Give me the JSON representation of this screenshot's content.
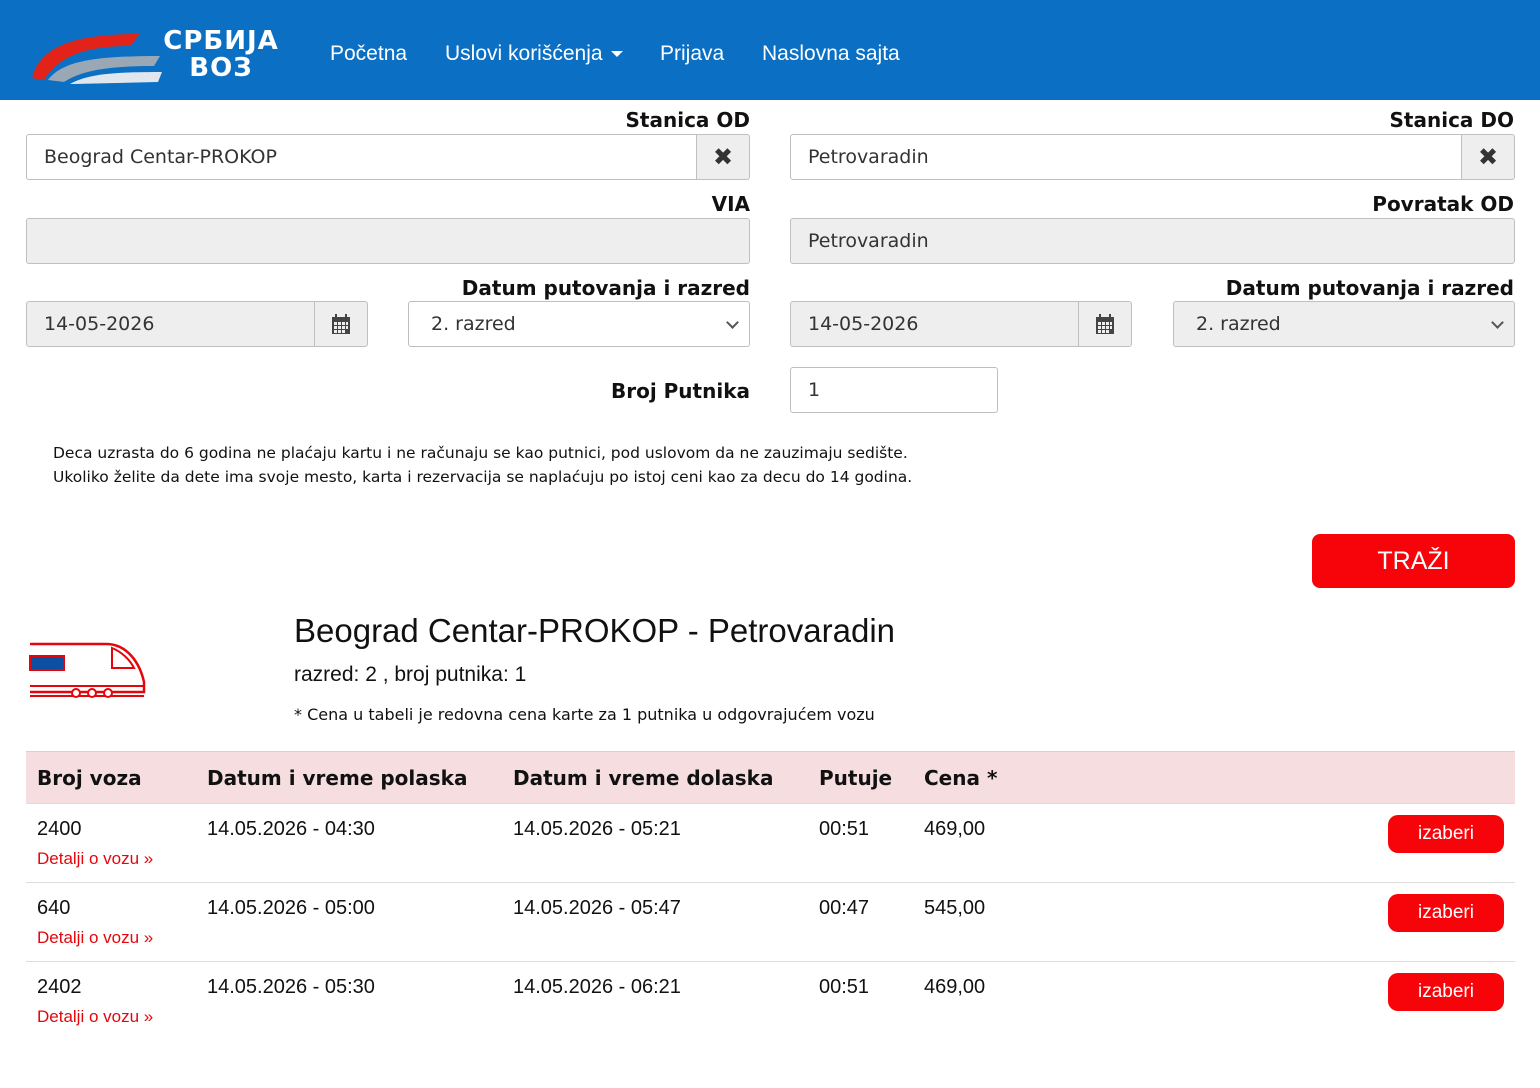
{
  "nav": {
    "logo_line1": "СРБИЈА",
    "logo_line2": "ВОЗ",
    "items": [
      "Početna",
      "Uslovi korišćenja",
      "Prijava",
      "Naslovna sajta"
    ]
  },
  "form": {
    "from_label": "Stanica OD",
    "from_value": "Beograd Centar-PROKOP",
    "to_label": "Stanica DO",
    "to_value": "Petrovaradin",
    "via_label": "VIA",
    "via_value": "",
    "return_label": "Povratak OD",
    "return_value": "Petrovaradin",
    "date_label": "Datum putovanja i razred",
    "date_value": "14-05-2026",
    "class_value": "2. razred",
    "return_date_label": "Datum putovanja i razred",
    "return_date_value": "14-05-2026",
    "return_class_value": "2. razred",
    "passengers_label": "Broj Putnika",
    "passengers_value": "1",
    "note_line1": "Deca uzrasta do 6 godina ne plaćaju kartu i ne računaju se kao putnici, pod uslovom da ne zauzimaju sedište.",
    "note_line2": "Ukoliko želite da dete ima svoje mesto, karta i rezervacija se naplaćuju po istoj ceni kao za decu do 14 godina.",
    "search_label": "TRAŽI"
  },
  "result": {
    "title": "Beograd Centar-PROKOP - Petrovaradin",
    "subtitle": "razred: 2 , broj putnika: 1",
    "price_note": "* Cena u tabeli je redovna cena karte za 1 putnika u odgovrajućem vozu",
    "columns": [
      "Broj voza",
      "Datum i vreme polaska",
      "Datum i vreme dolaska",
      "Putuje",
      "Cena *"
    ],
    "details_label": "Detalji o vozu »",
    "select_label": "izaberi",
    "rows": [
      {
        "train": "2400",
        "departure": "14.05.2026 - 04:30",
        "arrival": "14.05.2026 - 05:21",
        "duration": "00:51",
        "price": "469,00"
      },
      {
        "train": "640",
        "departure": "14.05.2026 - 05:00",
        "arrival": "14.05.2026 - 05:47",
        "duration": "00:47",
        "price": "545,00"
      },
      {
        "train": "2402",
        "departure": "14.05.2026 - 05:30",
        "arrival": "14.05.2026 - 06:21",
        "duration": "00:51",
        "price": "469,00"
      }
    ]
  },
  "colors": {
    "brand_blue": "#0b6fc3",
    "accent_red": "#f7040a",
    "table_header": "#f5dde0"
  },
  "icons": {
    "clear": "times-icon",
    "calendar": "calendar-icon",
    "train": "train-icon",
    "chevron": "chevron-down-icon"
  }
}
